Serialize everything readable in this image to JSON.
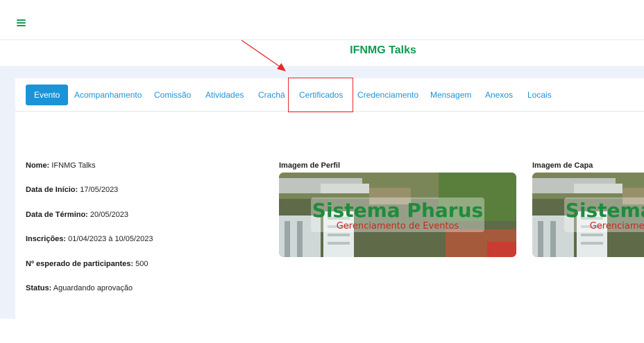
{
  "header": {
    "menu_icon": "hamburger-menu-icon",
    "event_title": "IFNMG Talks"
  },
  "tabs": [
    {
      "label": "Evento",
      "active": true
    },
    {
      "label": "Acompanhamento",
      "active": false
    },
    {
      "label": "Comissão",
      "active": false
    },
    {
      "label": "Atividades",
      "active": false
    },
    {
      "label": "Crachá",
      "active": false
    },
    {
      "label": "Certificados",
      "active": false
    },
    {
      "label": "Credenciamento",
      "active": false
    },
    {
      "label": "Mensagem",
      "active": false
    },
    {
      "label": "Anexos",
      "active": false
    },
    {
      "label": "Locais",
      "active": false
    }
  ],
  "details": {
    "nome": {
      "label": "Nome:",
      "value": "IFNMG Talks"
    },
    "data_inicio": {
      "label": "Data de Início:",
      "value": "17/05/2023"
    },
    "data_termino": {
      "label": "Data de Término:",
      "value": "20/05/2023"
    },
    "inscricoes": {
      "label": "Inscrições:",
      "value": "01/04/2023 à 10/05/2023"
    },
    "participantes": {
      "label": "Nº esperado de participantes:",
      "value": "500"
    },
    "status": {
      "label": "Status:",
      "value": "Aguardando aprovação"
    }
  },
  "images": {
    "perfil_label": "Imagem de Perfil",
    "capa_label": "Imagem de Capa",
    "banner_title": "Sistema Pharus",
    "banner_subtitle": "Gerenciamento de Eventos"
  },
  "annotation": {
    "highlighted_tab": "Certificados",
    "color": "#e8262b"
  },
  "colors": {
    "brand_green": "#129a4f",
    "link_blue": "#1b93d8",
    "page_bg": "#edf2fa"
  }
}
